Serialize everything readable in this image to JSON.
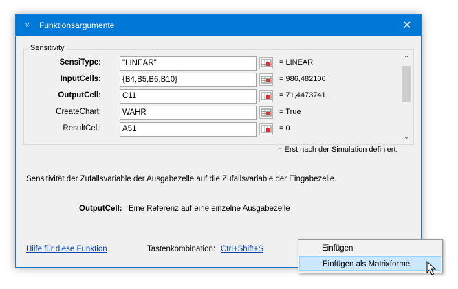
{
  "window": {
    "icon": "x",
    "title": "Funktionsargumente",
    "close": "✕"
  },
  "function_group": {
    "legend": "Sensitivity"
  },
  "arguments": [
    {
      "label": "SensiType:",
      "bold": true,
      "value": "\"LINEAR\"",
      "result": "= LINEAR"
    },
    {
      "label": "InputCells:",
      "bold": true,
      "value": "{B4,B5,B6,B10}",
      "result": "= 986,482106"
    },
    {
      "label": "OutputCell:",
      "bold": true,
      "value": "C11",
      "result": "= 71,4473741"
    },
    {
      "label": "CreateChart:",
      "bold": false,
      "value": "WAHR",
      "result": "= True"
    },
    {
      "label": "ResultCell:",
      "bold": false,
      "value": "A51",
      "result": "= 0"
    }
  ],
  "note": "=  Erst nach der Simulation definiert.",
  "description": "Sensitivität der Zufallsvariable der Ausgabezelle auf die Zufallsvariable der Eingabezelle.",
  "arg_description": {
    "label": "OutputCell:",
    "text": "Eine Referenz auf eine einzelne Ausgabezelle"
  },
  "footer": {
    "help_link": "Hilfe für diese Funktion",
    "shortcut_label": "Tastenkombination:",
    "shortcut_key": "Ctrl+Shift+S"
  },
  "context_menu": {
    "items": [
      {
        "label": "Einfügen"
      },
      {
        "label": "Einfügen als Matrixformel"
      }
    ]
  },
  "colors": {
    "titlebar": "#0078d7",
    "link": "#0645ad",
    "menu_hover": "#cce8ff"
  }
}
